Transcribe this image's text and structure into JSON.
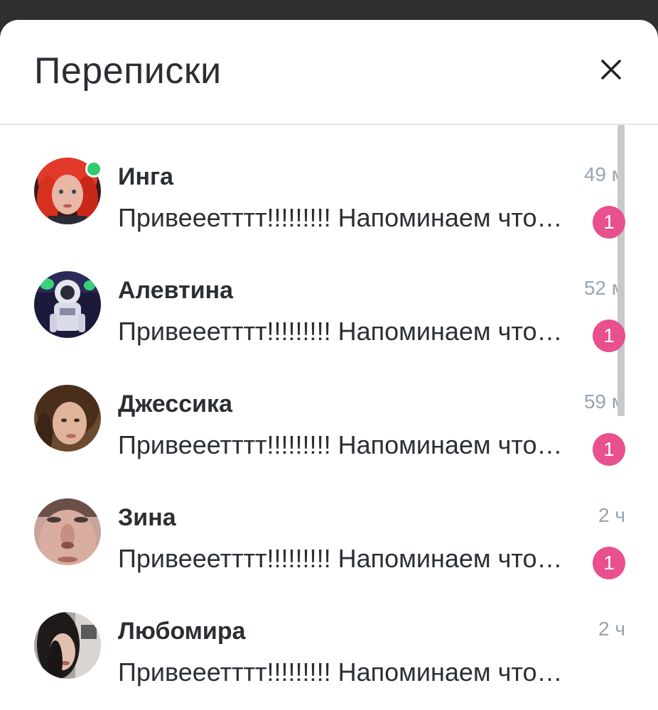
{
  "header": {
    "title": "Переписки",
    "close_icon": "close-icon"
  },
  "conversations": [
    {
      "name": "Инга",
      "time": "49 м",
      "preview": "Привееетттт!!!!!!!!! Напоминаем что…",
      "unread": "1",
      "online": true
    },
    {
      "name": "Алевтина",
      "time": "52 м",
      "preview": "Привееетттт!!!!!!!!! Напоминаем что…",
      "unread": "1",
      "online": false
    },
    {
      "name": "Джессика",
      "time": "59 м",
      "preview": "Привееетттт!!!!!!!!! Напоминаем что…",
      "unread": "1",
      "online": false
    },
    {
      "name": "Зина",
      "time": "2 ч",
      "preview": "Привееетттт!!!!!!!!! Напоминаем что…",
      "unread": "1",
      "online": false
    },
    {
      "name": "Любомира",
      "time": "2 ч",
      "preview": "Привееетттт!!!!!!!!! Напоминаем что…",
      "unread": "",
      "online": false
    }
  ],
  "colors": {
    "badge": "#e8508e",
    "online": "#2ecb72",
    "text": "#2b2f33",
    "muted": "#9aa4ae"
  }
}
